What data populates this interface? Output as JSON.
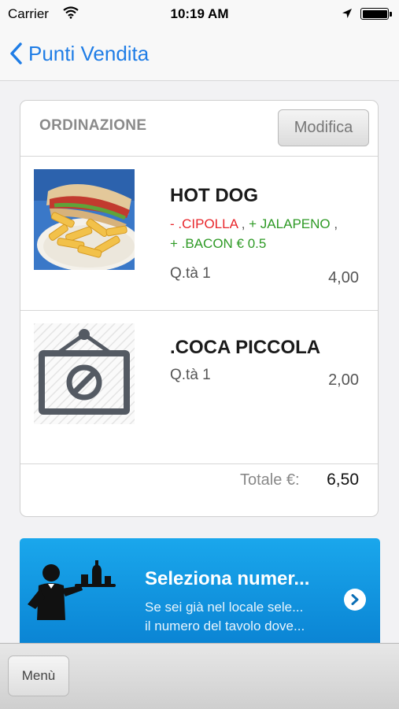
{
  "status_bar": {
    "carrier": "Carrier",
    "time": "10:19 AM",
    "battery_level": 1.0
  },
  "nav": {
    "back_label": "Punti Vendita"
  },
  "order": {
    "header_title": "ORDINAZIONE",
    "edit_label": "Modifica",
    "items": [
      {
        "name": "HOT DOG",
        "image": "food-photo",
        "modifiers": [
          {
            "text": "- .CIPOLLA",
            "type": "removed",
            "color": "#e8262b"
          },
          {
            "text": "+ JALAPENO",
            "type": "added",
            "color": "#2e9a25"
          },
          {
            "text": "+ .BACON € 0.5",
            "type": "added",
            "color": "#2e9a25"
          }
        ],
        "qty": "Q.tà 1",
        "price": "4,00"
      },
      {
        "name": ".COCA PICCOLA",
        "image": "no-image-placeholder-icon",
        "modifiers": [],
        "qty": "Q.tà 1",
        "price": "2,00"
      }
    ],
    "total_label": "Totale €:",
    "total_value": "6,50"
  },
  "banner": {
    "title": "Seleziona numer...",
    "line1": "Se sei già nel locale sele...",
    "line2": "il numero del tavolo dove...",
    "icon": "waiter-icon",
    "color": "#0e95de"
  },
  "toolbar": {
    "menu_label": "Menù"
  },
  "colors": {
    "accent": "#1f7de6",
    "removed": "#e8262b",
    "added": "#2e9a25"
  }
}
